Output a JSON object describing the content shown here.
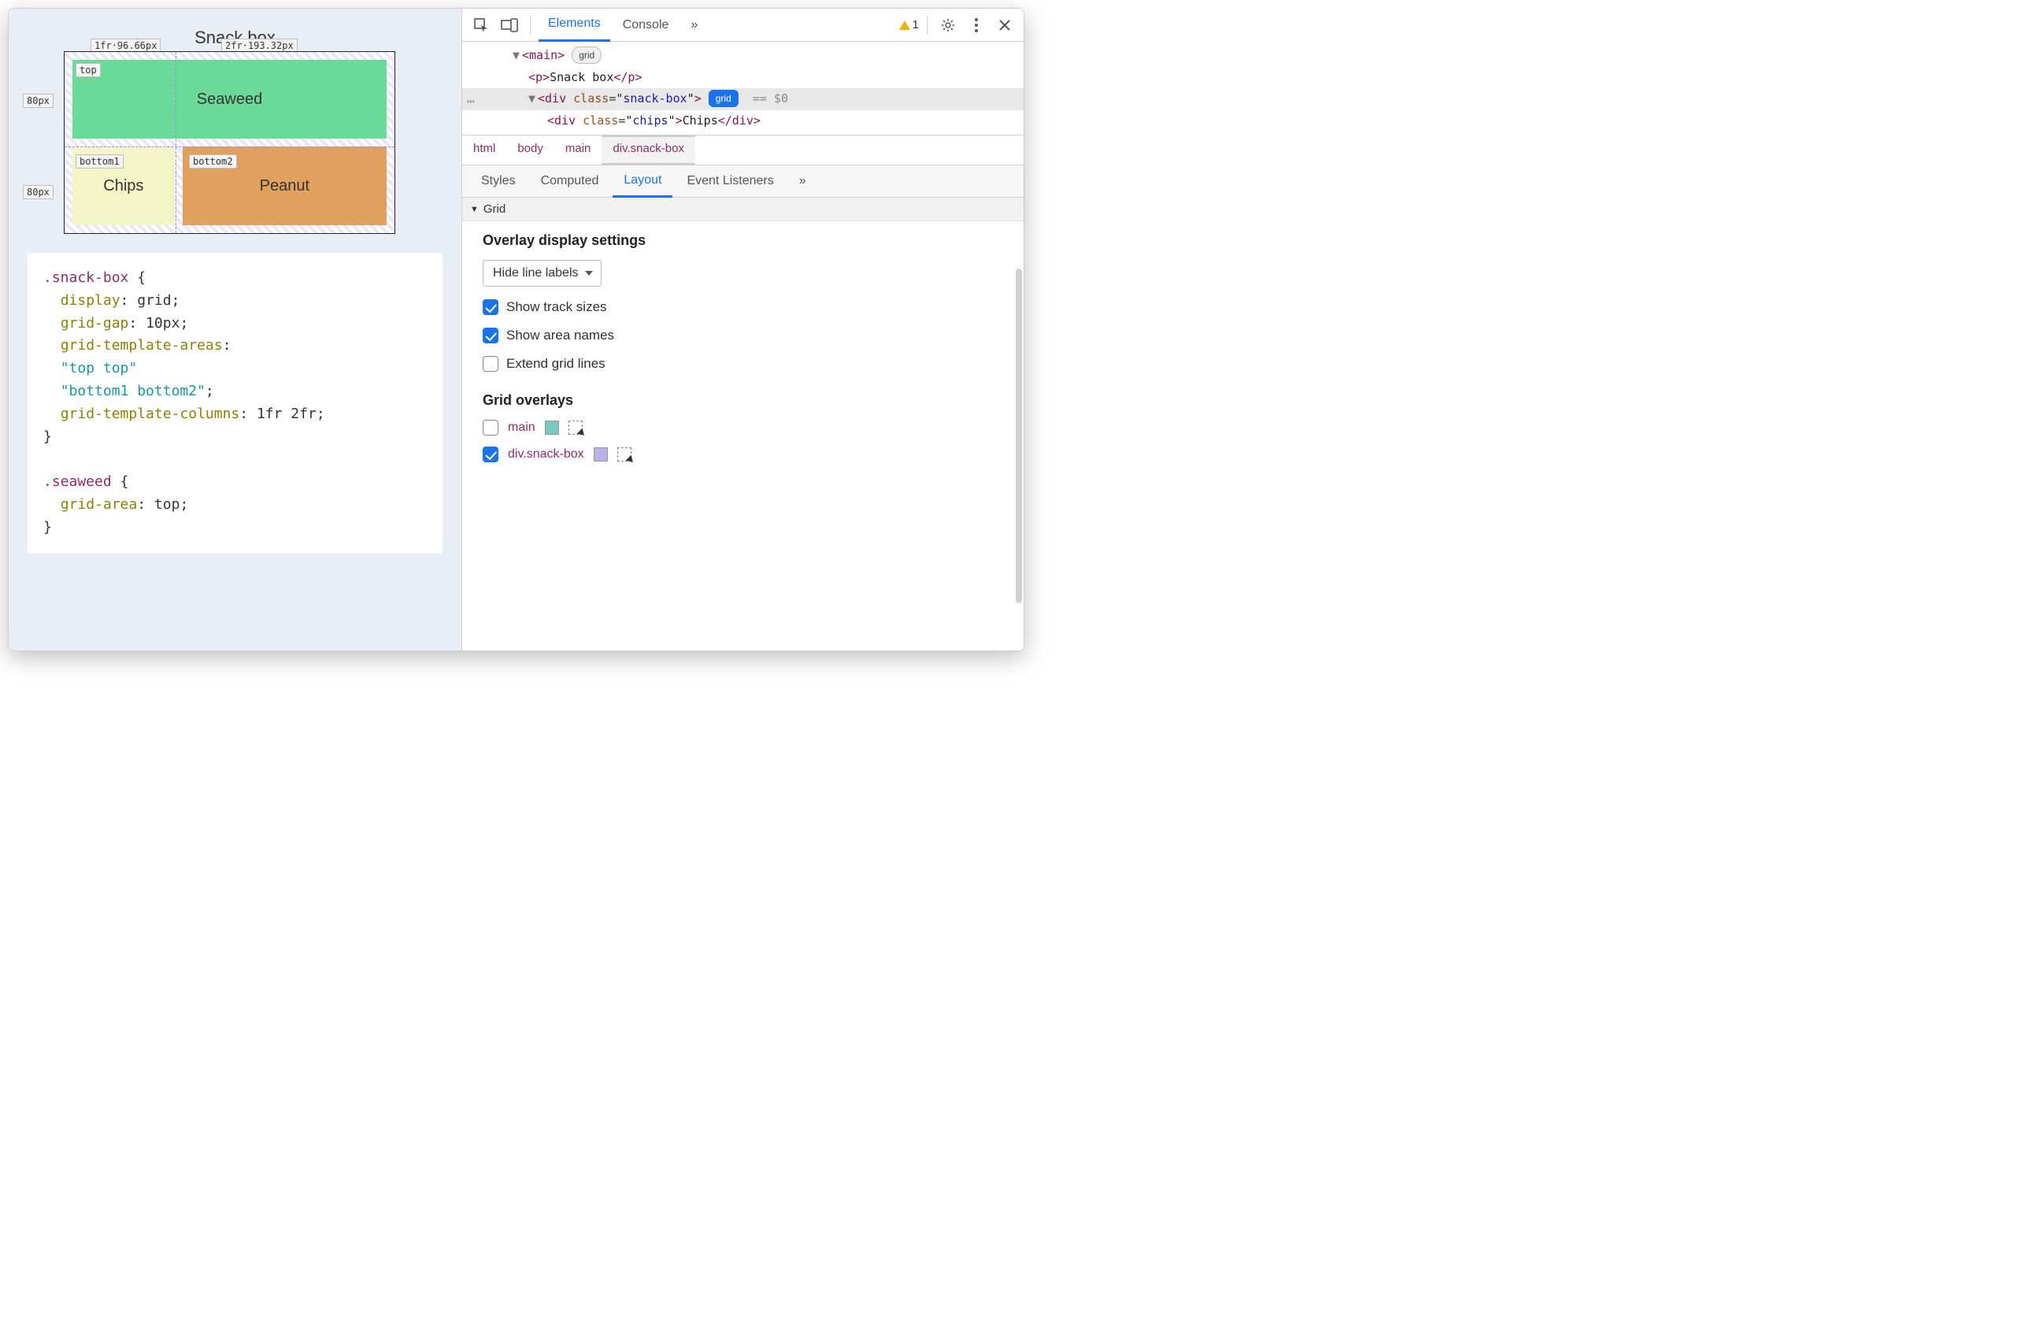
{
  "preview": {
    "title": "Snack box",
    "cells": {
      "seaweed": "Seaweed",
      "chips": "Chips",
      "peanut": "Peanut"
    },
    "track_labels": {
      "col1": "1fr·96.66px",
      "col2": "2fr·193.32px",
      "row1": "80px",
      "row2": "80px"
    },
    "area_labels": {
      "top": "top",
      "bottom1": "bottom1",
      "bottom2": "bottom2"
    }
  },
  "code": {
    "sel1": ".snack-box",
    "p1": "display",
    "v1": "grid",
    "p2": "grid-gap",
    "v2": "10px",
    "p3": "grid-template-areas",
    "s1": "\"top top\"",
    "s2": "\"bottom1 bottom2\"",
    "p4": "grid-template-columns",
    "v4": "1fr 2fr",
    "sel2": ".seaweed",
    "p5": "grid-area",
    "v5": "top"
  },
  "devtools": {
    "tabs": {
      "elements": "Elements",
      "console": "Console",
      "more": "»"
    },
    "warn_count": "1",
    "dom": {
      "main_open": "main",
      "main_badge": "grid",
      "p_text": "Snack box",
      "div_class": "snack-box",
      "div_badge": "grid",
      "selected_ref": "== $0",
      "chips_class": "chips",
      "chips_text": "Chips"
    },
    "crumbs": [
      "html",
      "body",
      "main",
      "div.snack-box"
    ],
    "subtabs": {
      "styles": "Styles",
      "computed": "Computed",
      "layout": "Layout",
      "listeners": "Event Listeners",
      "more": "»"
    },
    "grid_section": "Grid",
    "overlay_settings_title": "Overlay display settings",
    "line_labels_select": "Hide line labels",
    "checks": {
      "track": "Show track sizes",
      "area": "Show area names",
      "extend": "Extend grid lines"
    },
    "grid_overlays_title": "Grid overlays",
    "overlays": {
      "main": "main",
      "snack": "div.snack-box"
    }
  }
}
